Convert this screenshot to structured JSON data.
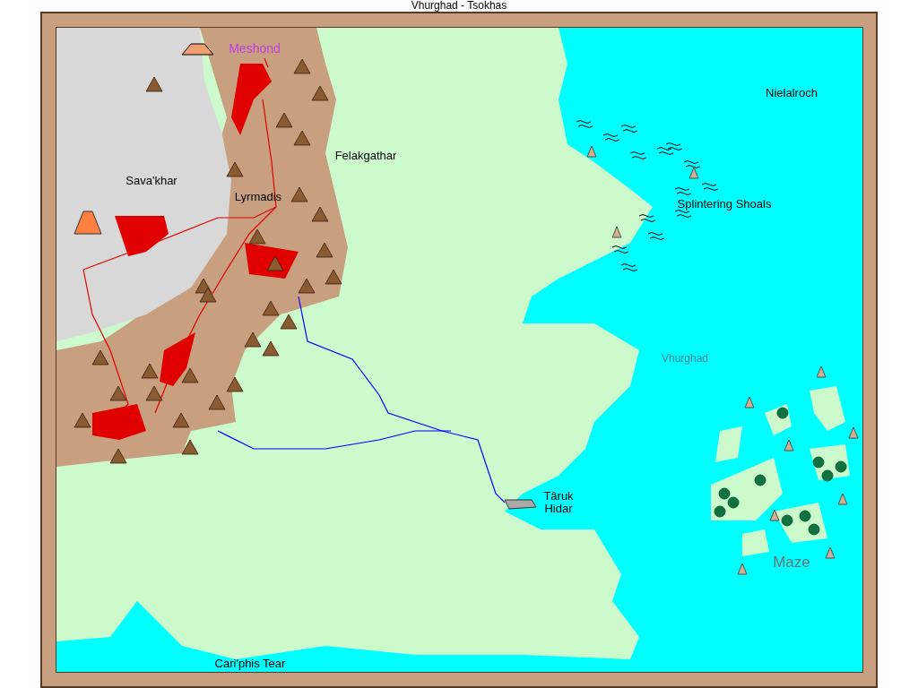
{
  "title": "Vhurghad - Tsokhas",
  "labels": [
    {
      "text": "Meshond",
      "kind": "capital"
    },
    {
      "text": "Nielalroch",
      "kind": "place"
    },
    {
      "text": "Felakgathar",
      "kind": "place"
    },
    {
      "text": "Sava'khar",
      "kind": "place"
    },
    {
      "text": "Lyrmadis",
      "kind": "place"
    },
    {
      "text": "Splintering Shoals",
      "kind": "place"
    },
    {
      "text": "Vhurghad",
      "kind": "sea"
    },
    {
      "text": "Târuk Hidar",
      "kind": "place"
    },
    {
      "text": "Maze",
      "kind": "islands"
    },
    {
      "text": "Cari'phis Tear",
      "kind": "place"
    }
  ]
}
